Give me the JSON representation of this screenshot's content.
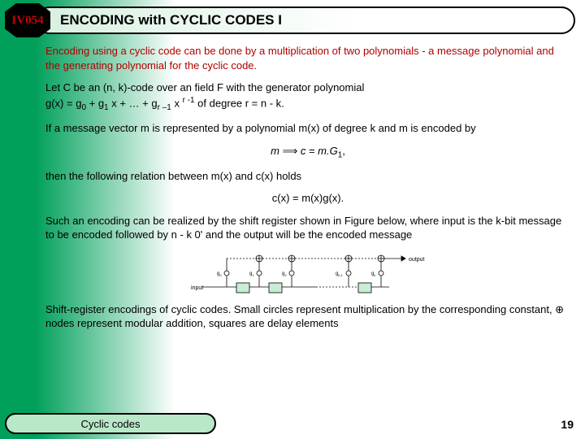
{
  "badge": "IV054",
  "title": "ENCODING with CYCLIC CODES  I",
  "intro": "Encoding using a cyclic code can be done by a multiplication of two polynomials - a message polynomial and the generating polynomial for the cyclic code.",
  "p1a": "Let C be an (n, k)-code over an field F with the generator polynomial",
  "p1b": "g(x) = g",
  "p1b_sub0": "0",
  "p1b_mid": " +      g",
  "p1b_sub1": "1",
  "p1b_mid2": " x + … + g",
  "p1b_subr": "r –1",
  "p1b_mid3": " x ",
  "p1b_sup": "r -1",
  "p1b_end": " of degree r = n - k.",
  "p2": "If a message vector m is represented by a polynomial m(x) of degree k and m is encoded by",
  "eq1_left": "m ",
  "eq1_right": " c = m.G",
  "eq1_sub": "1",
  "eq1_comma": ",",
  "p3": "then the following relation between m(x) and c(x) holds",
  "eq2": "c(x) = m(x)g(x).",
  "p4": "Such an encoding can be realized by the shift register shown in Figure below, where input is the k-bit message to be encoded followed by n - k 0' and the output will be the encoded message",
  "fig_output": "output",
  "fig_input": "input",
  "fig_g0": "g",
  "fig_g1": "g",
  "fig_g2": "g",
  "fig_gk1": "g",
  "fig_gk": "g",
  "p5": "Shift-register encodings of cyclic codes. Small circles represent multiplication by the corresponding constant, ⊕ nodes represent modular addition, squares are delay elements",
  "footer": "Cyclic codes",
  "page": "19"
}
